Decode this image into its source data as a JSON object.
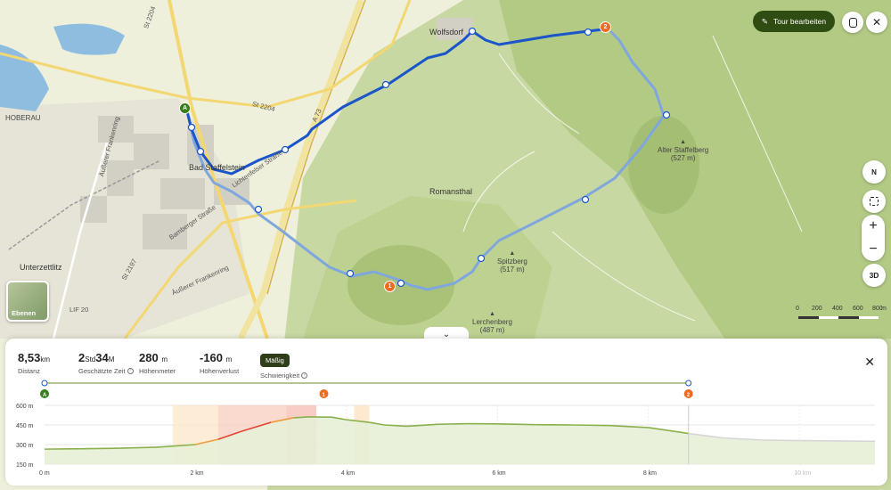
{
  "map": {
    "towns": [
      "Wolfsdorf",
      "Bad Staffelstein",
      "Romansthal",
      "Unterzettlitz",
      "HOBERAU"
    ],
    "peaks": [
      {
        "name": "Alter Staffelberg",
        "elev": "(527 m)"
      },
      {
        "name": "Spitzberg",
        "elev": "(517 m)"
      },
      {
        "name": "Lerchenberg",
        "elev": "(487 m)"
      }
    ],
    "roads": [
      "St 2204",
      "St 2204",
      "A 73",
      "St 2197",
      "Äußerer Frankenring",
      "Bamberger Straße",
      "Lichtenfelser Straße",
      "LIF 20",
      "Äußerer Frankenring"
    ],
    "markers": {
      "start": "A",
      "poi1": "1",
      "poi2": "2"
    },
    "colors": {
      "route": "#1a56c9",
      "route_past": "#7fa7dd",
      "poi": "#f06b22",
      "start": "#3a7d1e"
    }
  },
  "toolbar": {
    "edit_tour_label": "Tour bearbeiten",
    "close_label": "✕"
  },
  "controls": {
    "compass_label": "N",
    "zoom_in": "+",
    "zoom_out": "−",
    "three_d": "3D",
    "layers_label": "Ebenen"
  },
  "scale": {
    "labels": [
      "0",
      "200",
      "400",
      "600",
      "800",
      "m"
    ]
  },
  "stats": {
    "distance": {
      "value": "8,53",
      "unit": "km",
      "label": "Distanz"
    },
    "time": {
      "hours": "2",
      "hours_unit": "Std",
      "minutes": "34",
      "minutes_unit": "M",
      "label": "Geschätzte Zeit"
    },
    "ascent": {
      "value": "280",
      "unit": "m",
      "label": "Höhenmeter"
    },
    "descent": {
      "value": "-160",
      "unit": "m",
      "label": "Höhenverlust"
    },
    "difficulty": {
      "value": "Mäßig",
      "label": "Schwierigkeit"
    }
  },
  "panel": {
    "close_label": "✕",
    "collapse_label": "⌄"
  },
  "chart_data": {
    "type": "area",
    "y_ticks": [
      "600 m",
      "450 m",
      "300 m",
      "150 m"
    ],
    "x_ticks": [
      "0 m",
      "2 km",
      "4 km",
      "6 km",
      "8 km",
      "10 km"
    ],
    "ylim": [
      150,
      600
    ],
    "xlim": [
      0,
      11
    ],
    "route_end_km": 8.53,
    "x": [
      0,
      0.5,
      1,
      1.5,
      2,
      2.3,
      2.6,
      3,
      3.3,
      3.5,
      3.8,
      4.0,
      4.3,
      4.5,
      4.8,
      5.2,
      5.6,
      6,
      6.5,
      7,
      7.5,
      8,
      8.53,
      9,
      9.5,
      10,
      11
    ],
    "values": [
      265,
      268,
      272,
      280,
      300,
      340,
      400,
      470,
      505,
      512,
      510,
      490,
      470,
      450,
      440,
      455,
      460,
      458,
      452,
      450,
      445,
      430,
      385,
      350,
      335,
      330,
      325
    ],
    "markers": [
      {
        "x": 0,
        "label": "A"
      },
      {
        "x": 3.7,
        "label": "1"
      },
      {
        "x": 8.53,
        "label": "2"
      }
    ]
  }
}
